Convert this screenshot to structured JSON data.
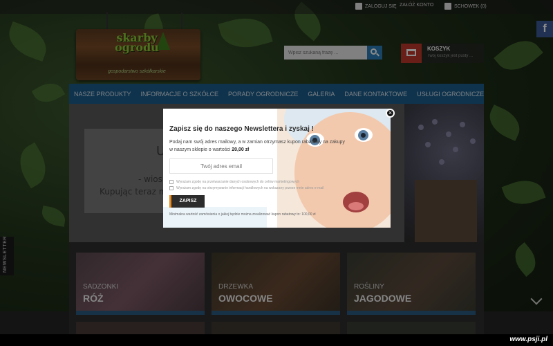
{
  "topbar": {
    "login_label": "ZALOGUJ SIĘ",
    "register_label": "ZAŁÓŻ KONTO",
    "clipboard_label": "SCHOWEK (0)"
  },
  "social": {
    "facebook_letter": "f"
  },
  "logo": {
    "line1": "skarby",
    "line2": "ogrodu",
    "subtitle": "gospodarstwo szkółkarskie"
  },
  "search": {
    "placeholder": "Wpisz szukaną frazę ..."
  },
  "cart": {
    "title": "KOSZYK",
    "subtitle": "Twój koszyk jest pusty ..."
  },
  "nav": {
    "items": [
      {
        "label": "Nasze produkty"
      },
      {
        "label": "Informacje o szkółce"
      },
      {
        "label": "Porady ogrodnicze"
      },
      {
        "label": "Galeria"
      },
      {
        "label": "Dane kontaktowe"
      },
      {
        "label": "Usługi ogrodnicze"
      }
    ]
  },
  "slider": {
    "line1": "U",
    "line2": "- wiosną",
    "line3": "Kupując teraz masz"
  },
  "tiles": [
    {
      "line1": "Sadzonki",
      "line2": "Róż"
    },
    {
      "line1": "Drzewka",
      "line2": "Owocowe"
    },
    {
      "line1": "Rośliny",
      "line2": "Jagodowe"
    }
  ],
  "newsletter_tab": "NEWSLETTER",
  "modal": {
    "title": "Zapisz się do naszego Newslettera i zyskaj !",
    "desc_prefix": "Podaj nam swój adres mailowy, a w zamian otrzymasz kupon rabatowy na zakupy w naszym sklepie o wartości ",
    "desc_amount": "20,00 zł",
    "email_placeholder": "Twój adres email",
    "consent_data": "Wyrażam zgodę na przetwarzanie danych osobowych do celów marketingowych",
    "consent_info": "Wyrażam zgodę na otrzymywanie informacji handlowych na wskazany przeze mnie adres e-mail",
    "submit_label": "ZAPISZ",
    "note": "Minimalna wartość zamówienia o jakiej będzie można zrealizować kupon rabatowy to: 100,00 zł",
    "close_label": "×"
  },
  "watermark": "www.psji.pl",
  "colors": {
    "nav_bg": "#1d5d8c",
    "cart_red": "#c0392b",
    "search_btn": "#2d7fb8",
    "submit_accent": "#e6891b",
    "logo_green": "#8fcc3a"
  }
}
